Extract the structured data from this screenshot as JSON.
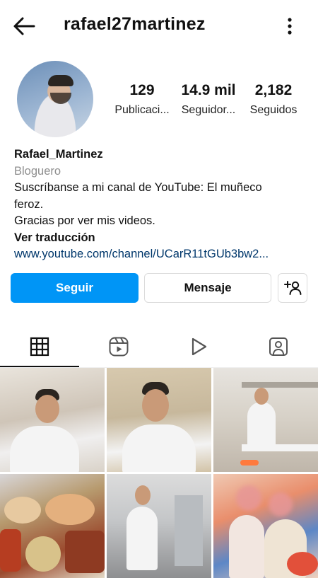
{
  "header": {
    "username": "rafael27martinez",
    "back_icon": "arrow-left-icon",
    "more_icon": "more-vertical-icon"
  },
  "stats": {
    "posts_count": "129",
    "posts_label": "Publicaci...",
    "followers_count": "14.9 mil",
    "followers_label": "Seguidor...",
    "following_count": "2,182",
    "following_label": "Seguidos"
  },
  "bio": {
    "name": "Rafael_Martinez",
    "category": "Bloguero",
    "line1": "Suscríbanse a mi canal de YouTube: El muñeco",
    "line2": "feroz.",
    "line3": "Gracias por ver mis videos.",
    "translate": "Ver traducción",
    "link": "www.youtube.com/channel/UCarR11tGUb3bw2..."
  },
  "actions": {
    "follow": "Seguir",
    "message": "Mensaje",
    "add_person_icon": "add-person-icon"
  },
  "tabs": [
    {
      "icon": "grid-icon",
      "active": true
    },
    {
      "icon": "reels-icon",
      "active": false
    },
    {
      "icon": "play-icon",
      "active": false
    },
    {
      "icon": "tagged-icon",
      "active": false
    }
  ],
  "colors": {
    "accent": "#0095f6",
    "link": "#00376b",
    "muted": "#8e8e8e"
  }
}
